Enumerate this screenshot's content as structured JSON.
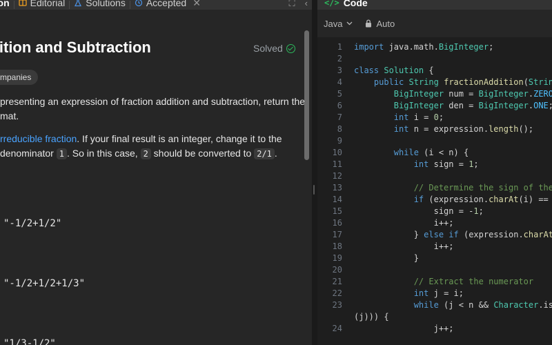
{
  "tabs": [
    {
      "label": "tion",
      "icon": "description-icon"
    },
    {
      "label": "Editorial",
      "icon": "book-icon"
    },
    {
      "label": "Solutions",
      "icon": "flask-icon"
    },
    {
      "label": "Accepted",
      "icon": "history-icon"
    }
  ],
  "tab_close": "✕",
  "problem": {
    "title": "ddition and Subtraction",
    "status": "Solved",
    "chip": "mpanies",
    "p1_line1": "presenting an expression of fraction addition and subtraction, return the",
    "p1_line2": "mat.",
    "p2_link": "rreducible fraction",
    "p2_line1_rest": ". If your final result is an integer, change it to the",
    "p2_line2_a": " denominator ",
    "p2_code1": "1",
    "p2_line2_b": ". So in this case, ",
    "p2_code2": "2",
    "p2_line2_c": " should be converted to ",
    "p2_code3": "2/1",
    "p2_line2_d": ".",
    "examples": [
      "\"-1/2+1/2\"",
      "\"-1/2+1/2+1/3\"",
      "\"1/3-1/2\""
    ]
  },
  "code_panel": {
    "title": "Code",
    "language": "Java",
    "mode": "Auto"
  },
  "code_lines": [
    {
      "n": "1",
      "text": "import java.math.BigInteger;"
    },
    {
      "n": "2",
      "text": ""
    },
    {
      "n": "3",
      "text": "class Solution {"
    },
    {
      "n": "4",
      "text": "    public String fractionAddition(String e"
    },
    {
      "n": "5",
      "text": "        BigInteger num = BigInteger.ZERO;"
    },
    {
      "n": "6",
      "text": "        BigInteger den = BigInteger.ONE;"
    },
    {
      "n": "7",
      "text": "        int i = 0;"
    },
    {
      "n": "8",
      "text": "        int n = expression.length();"
    },
    {
      "n": "9",
      "text": ""
    },
    {
      "n": "10",
      "text": "        while (i < n) {"
    },
    {
      "n": "11",
      "text": "            int sign = 1;"
    },
    {
      "n": "12",
      "text": ""
    },
    {
      "n": "13",
      "text": "            // Determine the sign of the cu"
    },
    {
      "n": "14",
      "text": "            if (expression.charAt(i) == '-'"
    },
    {
      "n": "15",
      "text": "                sign = -1;"
    },
    {
      "n": "16",
      "text": "                i++;"
    },
    {
      "n": "17",
      "text": "            } else if (expression.charAt(i)"
    },
    {
      "n": "18",
      "text": "                i++;"
    },
    {
      "n": "19",
      "text": "            }"
    },
    {
      "n": "20",
      "text": ""
    },
    {
      "n": "21",
      "text": "            // Extract the numerator"
    },
    {
      "n": "22",
      "text": "            int j = i;"
    },
    {
      "n": "23",
      "text": "            while (j < n && Character.isDig"
    },
    {
      "n": "",
      "text": "(j))) {"
    },
    {
      "n": "24",
      "text": "                j++;"
    }
  ],
  "colors": {
    "keyword": "#569cd6",
    "type": "#4ec9b0",
    "method": "#dcdcaa",
    "comment": "#6a9955",
    "number": "#b5cea8",
    "string": "#ce9178",
    "field": "#4fc1ff",
    "accent_green": "#2cbb5d",
    "link": "#4aa3ff"
  }
}
